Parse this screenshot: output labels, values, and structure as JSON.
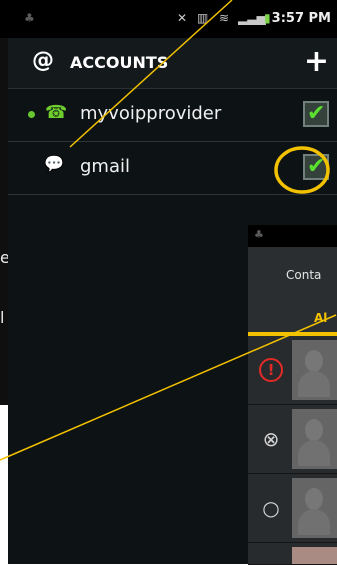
{
  "statusbar": {
    "time": "3:57 PM"
  },
  "accounts": {
    "title": "ACCOUNTS",
    "items": [
      {
        "label": "myvoipprovider",
        "checked": true,
        "status": "online"
      },
      {
        "label": "gmail",
        "checked": true,
        "status": ""
      }
    ]
  },
  "contacts": {
    "tab_label": "Conta",
    "all_label": "Al",
    "rows": [
      {
        "status_icon": "warning-icon",
        "status_symbol": "!",
        "color": "#e32b26"
      },
      {
        "status_icon": "busy-icon",
        "status_symbol": "⊗",
        "color": "#d4d4d4"
      },
      {
        "status_icon": "offline-icon",
        "status_symbol": "○",
        "color": "#d4d4d4"
      }
    ]
  },
  "background_app": {
    "text_fragments": [
      "e",
      "l"
    ]
  },
  "colors": {
    "accent": "#f2c100",
    "check_green": "#5ae02e",
    "annotation_yellow": "#f2c100"
  }
}
